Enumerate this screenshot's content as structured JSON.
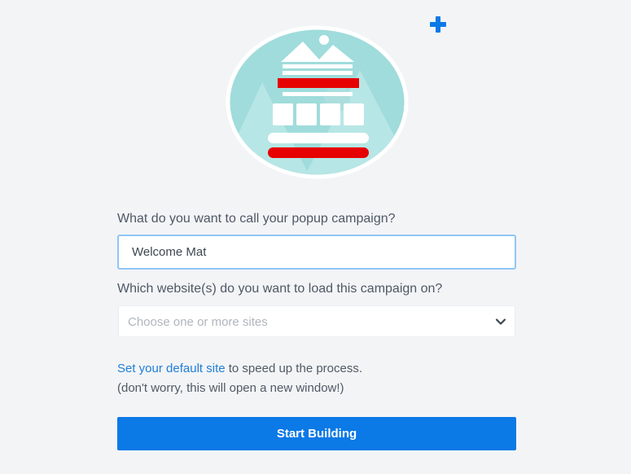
{
  "colors": {
    "background": "#f3f4f6",
    "accent": "#0b79e6",
    "link": "#1f7fd6",
    "illustration_teal": "#9fdcdb",
    "illustration_red": "#e60000"
  },
  "icons": {
    "add": "plus-icon",
    "dropdown": "chevron-down-icon",
    "illustration": "popup-illustration"
  },
  "form": {
    "name_question": "What do you want to call your popup campaign?",
    "name_value": "Welcome Mat",
    "sites_question": "Which website(s) do you want to load this campaign on?",
    "sites_placeholder": "Choose one or more sites"
  },
  "help": {
    "link_text": "Set your default site",
    "text_after_link": " to speed up the process.",
    "note": "(don't worry, this will open a new window!)"
  },
  "actions": {
    "start_label": "Start Building"
  }
}
